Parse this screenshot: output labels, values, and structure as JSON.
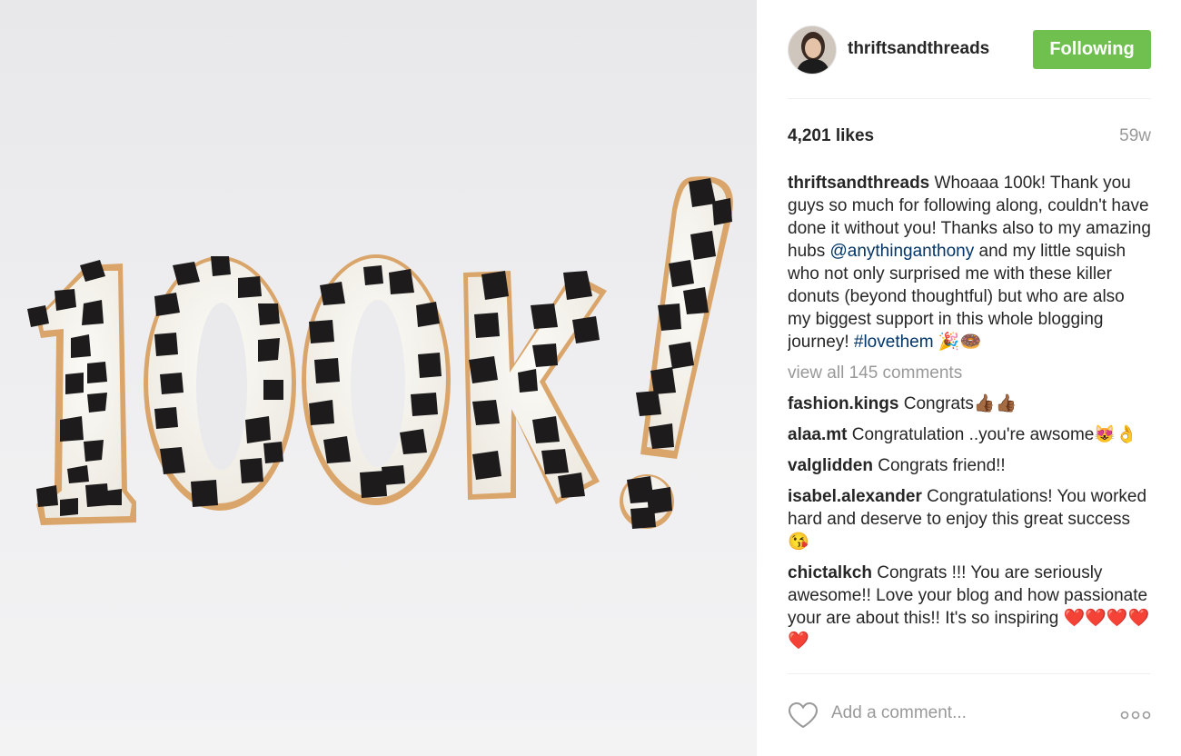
{
  "post": {
    "username": "thriftsandthreads",
    "follow_label": "Following",
    "likes": "4,201 likes",
    "time_ago": "59w"
  },
  "caption": {
    "user": "thriftsandthreads",
    "text_1": "Whoaaa 100k! Thank you guys so much for following along, couldn't have done it without you! Thanks also to my amazing hubs",
    "mention": "@anythinganthony",
    "text_2": "and my little squish who not only surprised me with these killer donuts (beyond thoughtful) but who are also my biggest support in this whole blogging journey!",
    "hashtag": "#lovethem",
    "emoji": "🎉🍩"
  },
  "view_all": "view all 145 comments",
  "comments": [
    {
      "user": "fashion.kings",
      "text": "Congrats👍🏾👍🏾"
    },
    {
      "user": "alaa.mt",
      "text": "Congratulation ..you're awsome😻👌"
    },
    {
      "user": "valglidden",
      "text": "Congrats friend!!"
    },
    {
      "user": "isabel.alexander",
      "text": "Congratulations! You worked hard and deserve to enjoy this great success 😘"
    },
    {
      "user": "chictalkch",
      "text": "Congrats !!! You are seriously awesome!! Love your blog and how passionate your are about this!! It's so inspiring ❤️❤️❤️❤️❤️"
    }
  ],
  "footer": {
    "add_comment_placeholder": "Add a comment...",
    "icons": [
      "heart-icon",
      "more-options-icon"
    ]
  },
  "colors": {
    "follow_green": "#70c050",
    "link_blue": "#003569",
    "muted_gray": "#999999"
  }
}
